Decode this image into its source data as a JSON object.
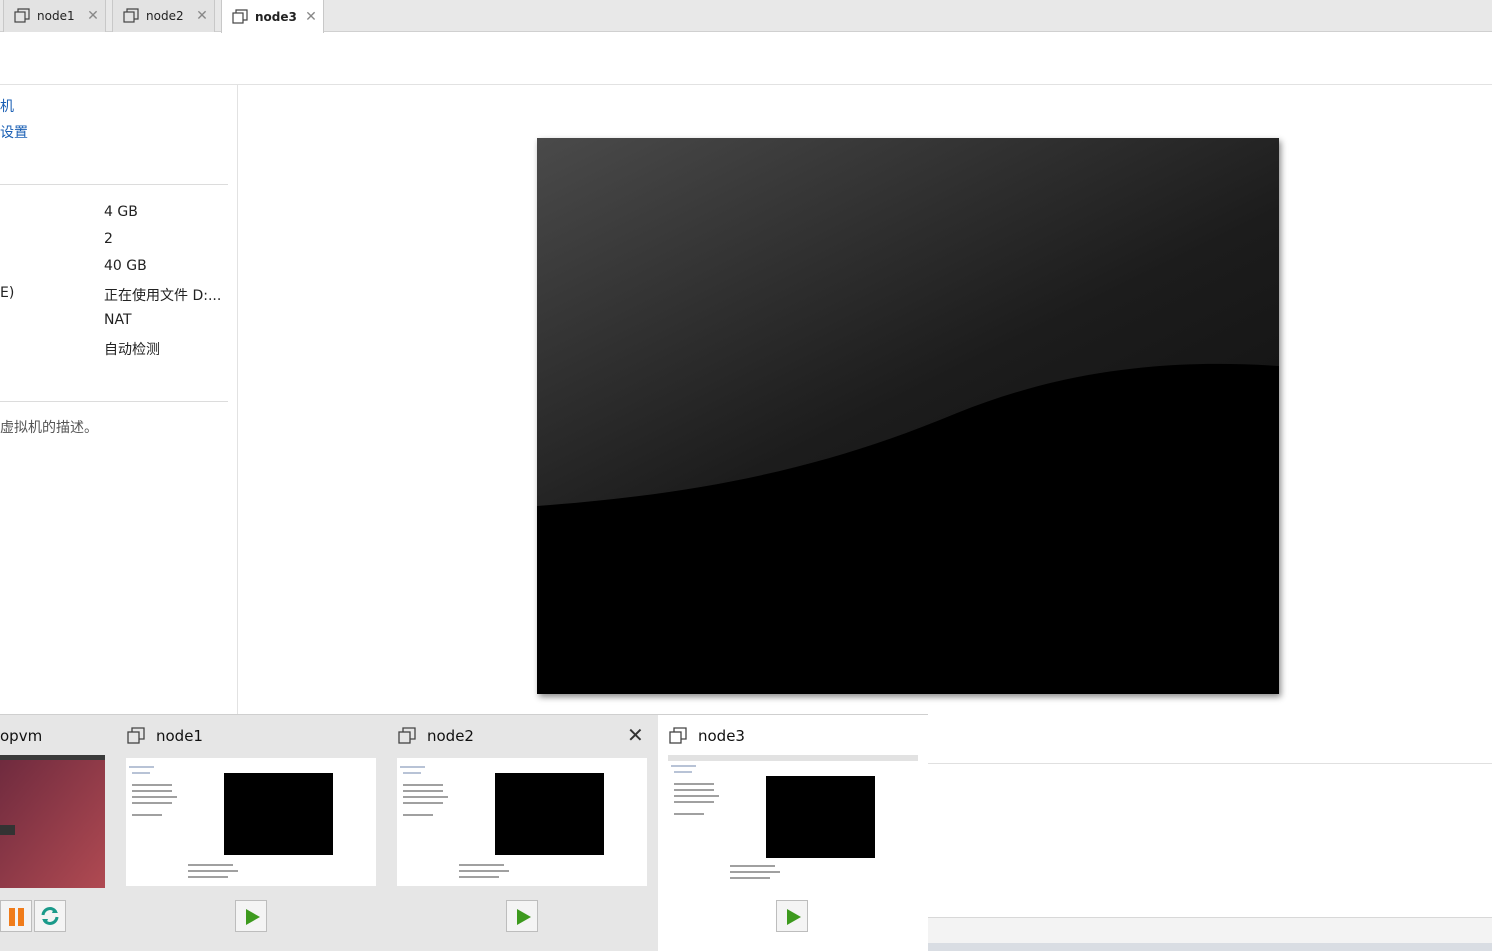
{
  "tabs": [
    {
      "label": "node1",
      "active": false
    },
    {
      "label": "node2",
      "active": false
    },
    {
      "label": "node3",
      "active": true
    }
  ],
  "left_panel": {
    "action_links": [
      "机",
      "设置"
    ],
    "devices": [
      {
        "label": "",
        "value": "4 GB"
      },
      {
        "label": "",
        "value": "2"
      },
      {
        "label": "",
        "value": "40 GB"
      },
      {
        "label": "E)",
        "value": "正在使用文件 D:..."
      },
      {
        "label": "",
        "value": "NAT"
      },
      {
        "label": "",
        "value": "自动检测"
      }
    ],
    "description": "虚拟机的描述。"
  },
  "thumbnails": [
    {
      "label": "opvm",
      "state": "running"
    },
    {
      "label": "node1",
      "state": "stopped"
    },
    {
      "label": "node2",
      "state": "stopped"
    },
    {
      "label": "node3",
      "state": "stopped",
      "active": true
    }
  ],
  "colors": {
    "link": "#1a5fb4",
    "play_green": "#3d9a1e",
    "pause_orange": "#f07c1b",
    "reset_teal": "#1a9a8a"
  },
  "icons": {
    "tab_icon": "vm-window-icon",
    "close_icon": "close-icon",
    "play_icon": "play-icon",
    "pause_icon": "pause-icon",
    "reset_icon": "reset-icon"
  }
}
